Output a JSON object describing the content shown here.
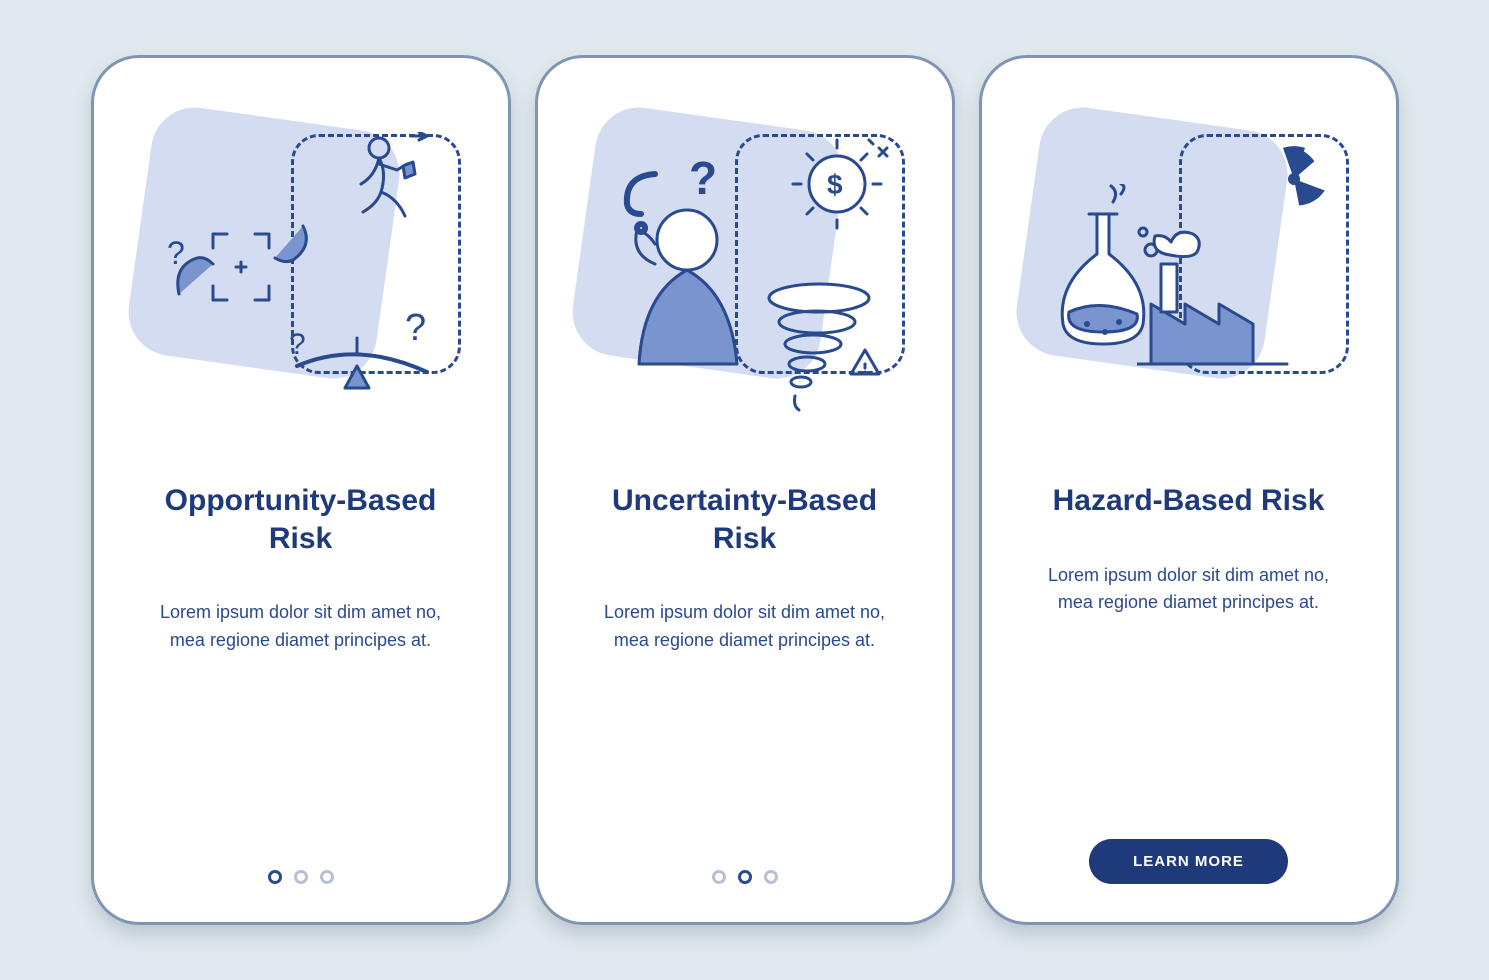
{
  "colors": {
    "background": "#e0e9ed",
    "card_bg": "#ffffff",
    "card_border": "#8095b3",
    "primary_dark": "#1f3a7a",
    "primary_mid": "#2a4a8f",
    "accent_light": "#d3dcf0",
    "dot_inactive": "#b7c1d6"
  },
  "common_description": "Lorem ipsum dolor sit dim amet no, mea regione diamet principes at.",
  "cards": [
    {
      "title": "Opportunity-Based Risk",
      "description": "Lorem ipsum dolor sit dim amet no, mea regione diamet principes at.",
      "illustration_icons": [
        "viewfinder-hand",
        "question-mark",
        "running-person",
        "flag",
        "balance-scale",
        "pointing-hand"
      ],
      "footer_type": "dots",
      "active_dot_index": 0,
      "dot_count": 3
    },
    {
      "title": "Uncertainty-Based Risk",
      "description": "Lorem ipsum dolor sit dim amet no, mea regione diamet principes at.",
      "illustration_icons": [
        "thinking-person",
        "question-mark",
        "gear-dollar",
        "tornado",
        "warning-triangle"
      ],
      "footer_type": "dots",
      "active_dot_index": 1,
      "dot_count": 3
    },
    {
      "title": "Hazard-Based Risk",
      "description": "Lorem ipsum dolor sit dim amet no, mea regione diamet principes at.",
      "illustration_icons": [
        "chemistry-flask",
        "smoke-cloud",
        "factory",
        "radiation",
        "warning-triangle",
        "open-hand"
      ],
      "footer_type": "button",
      "button_label": "LEARN MORE"
    }
  ]
}
